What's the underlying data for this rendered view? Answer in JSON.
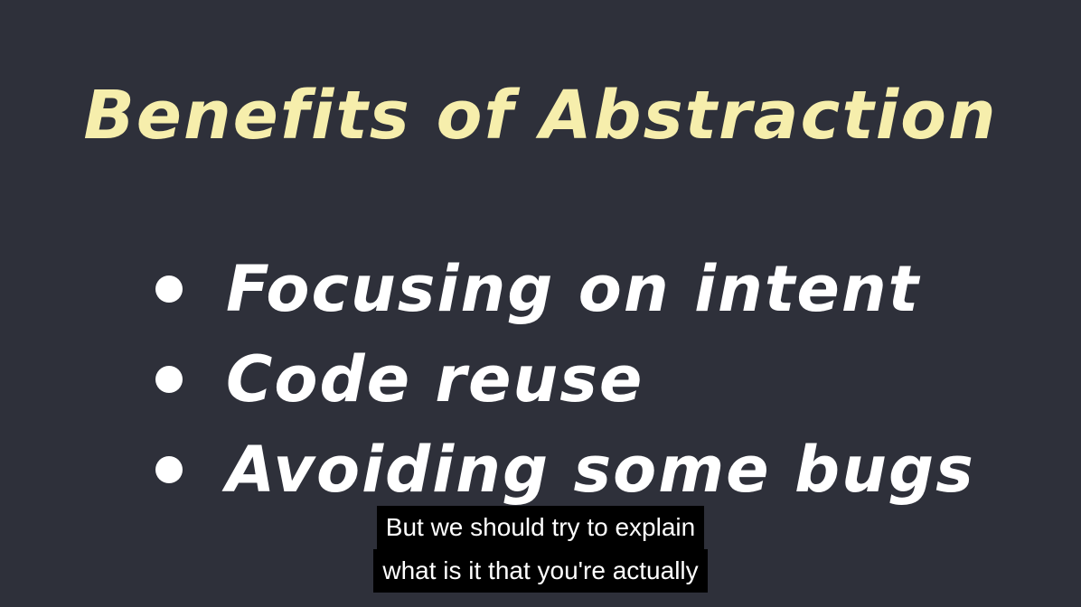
{
  "slide": {
    "title": "Benefits of Abstraction",
    "bullets": [
      "Focusing on intent",
      "Code reuse",
      "Avoiding some bugs"
    ],
    "colors": {
      "background": "#2e303a",
      "title": "#f6eeac",
      "bullet_text": "#ffffff"
    }
  },
  "captions": {
    "lines": [
      "But we should try to explain",
      "what is it that you're actually"
    ]
  }
}
